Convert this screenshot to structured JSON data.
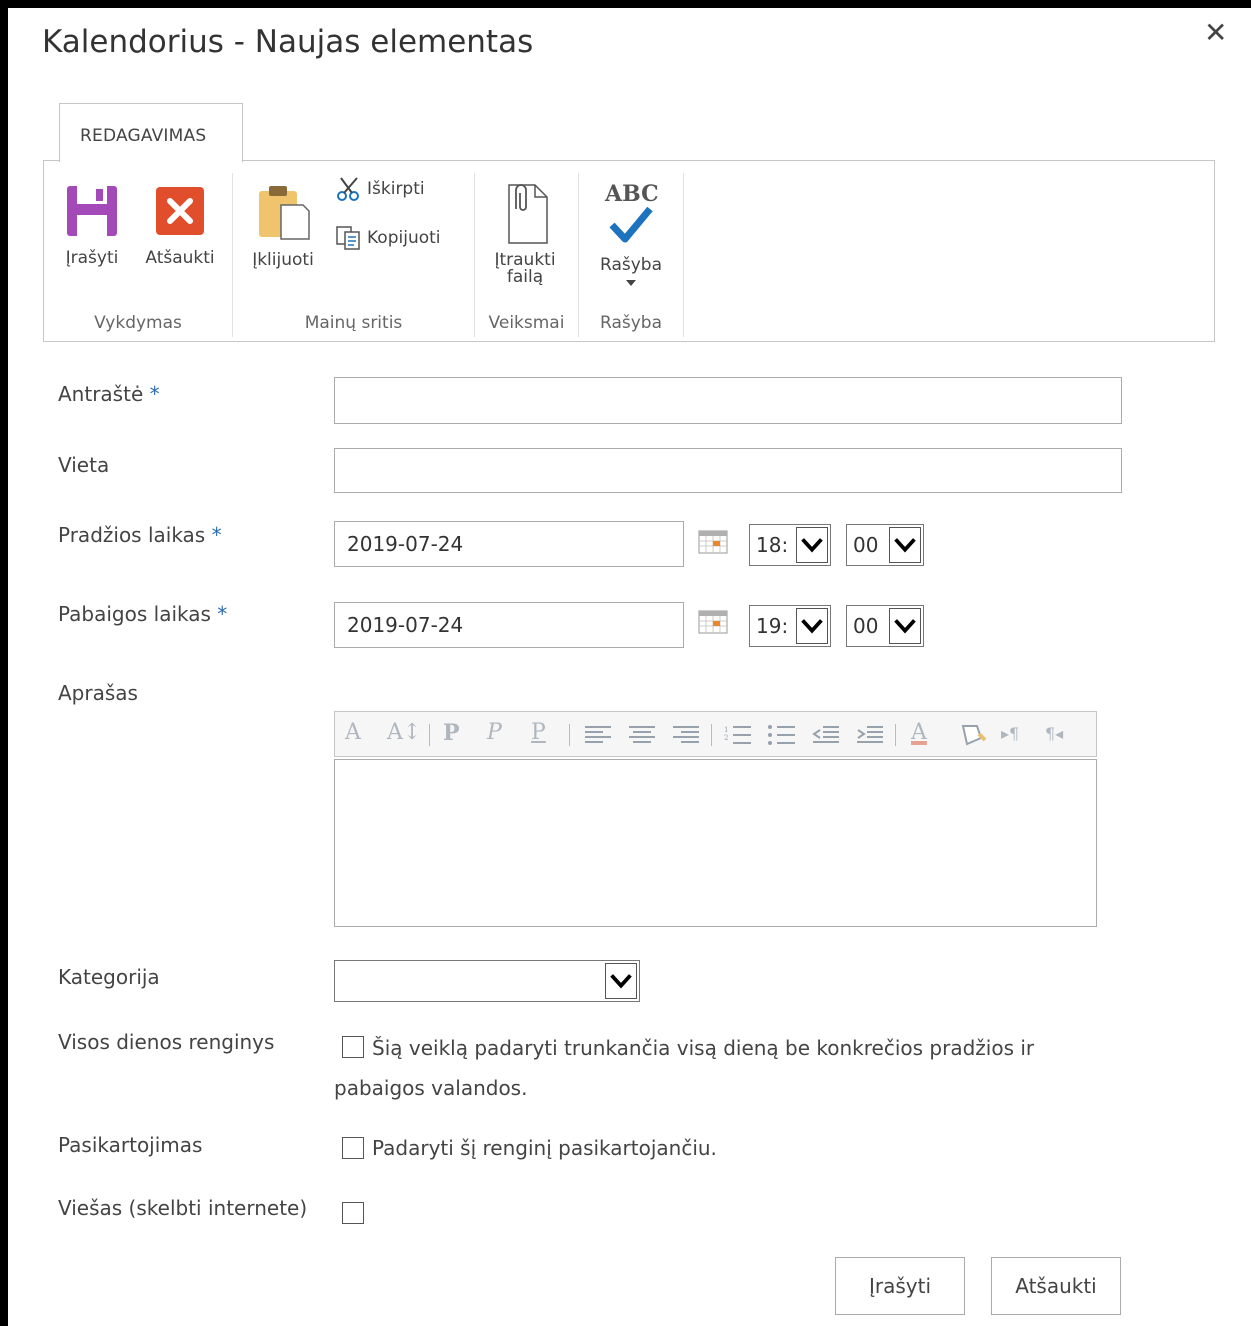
{
  "dialog": {
    "title": "Kalendorius - Naujas elementas",
    "close_glyph": "✕"
  },
  "ribbon": {
    "tab_label": "REDAGAVIMAS",
    "groups": [
      {
        "label": "Vykdymas",
        "buttons": [
          "Įrašyti",
          "Atšaukti"
        ]
      },
      {
        "label": "Mainų sritis",
        "buttons": [
          "Įklijuoti",
          "Iškirpti",
          "Kopijuoti"
        ]
      },
      {
        "label": "Veiksmai",
        "buttons": [
          "Įtraukti",
          "failą"
        ]
      },
      {
        "label": "Rašyba",
        "buttons": [
          "Rašyba"
        ],
        "icon_text": "ABC"
      }
    ]
  },
  "form": {
    "required_mark": "*",
    "title_label": "Antraštė",
    "location_label": "Vieta",
    "start_label": "Pradžios laikas",
    "start_date": "2019-07-24",
    "start_hour": "18:",
    "start_minute": "00",
    "end_label": "Pabaigos laikas",
    "end_date": "2019-07-24",
    "end_hour": "19:",
    "end_minute": "00",
    "description_label": "Aprašas",
    "category_label": "Kategorija",
    "category_value": "",
    "allday_label": "Visos dienos renginys",
    "allday_text_line1": "Šią veiklą padaryti trunkančia visą dieną be konkrečios pradžios ir",
    "allday_text_line2": "pabaigos valandos.",
    "recurrence_label": "Pasikartojimas",
    "recurrence_text": "Padaryti šį renginį pasikartojančiu.",
    "public_label": "Viešas (skelbti internete)"
  },
  "footer": {
    "save": "Įrašyti",
    "cancel": "Atšaukti"
  },
  "colors": {
    "save_icon": "#a44ab8",
    "cancel_icon": "#e04e2c",
    "required": "#2b6cb0",
    "check_icon": "#1e73be"
  }
}
